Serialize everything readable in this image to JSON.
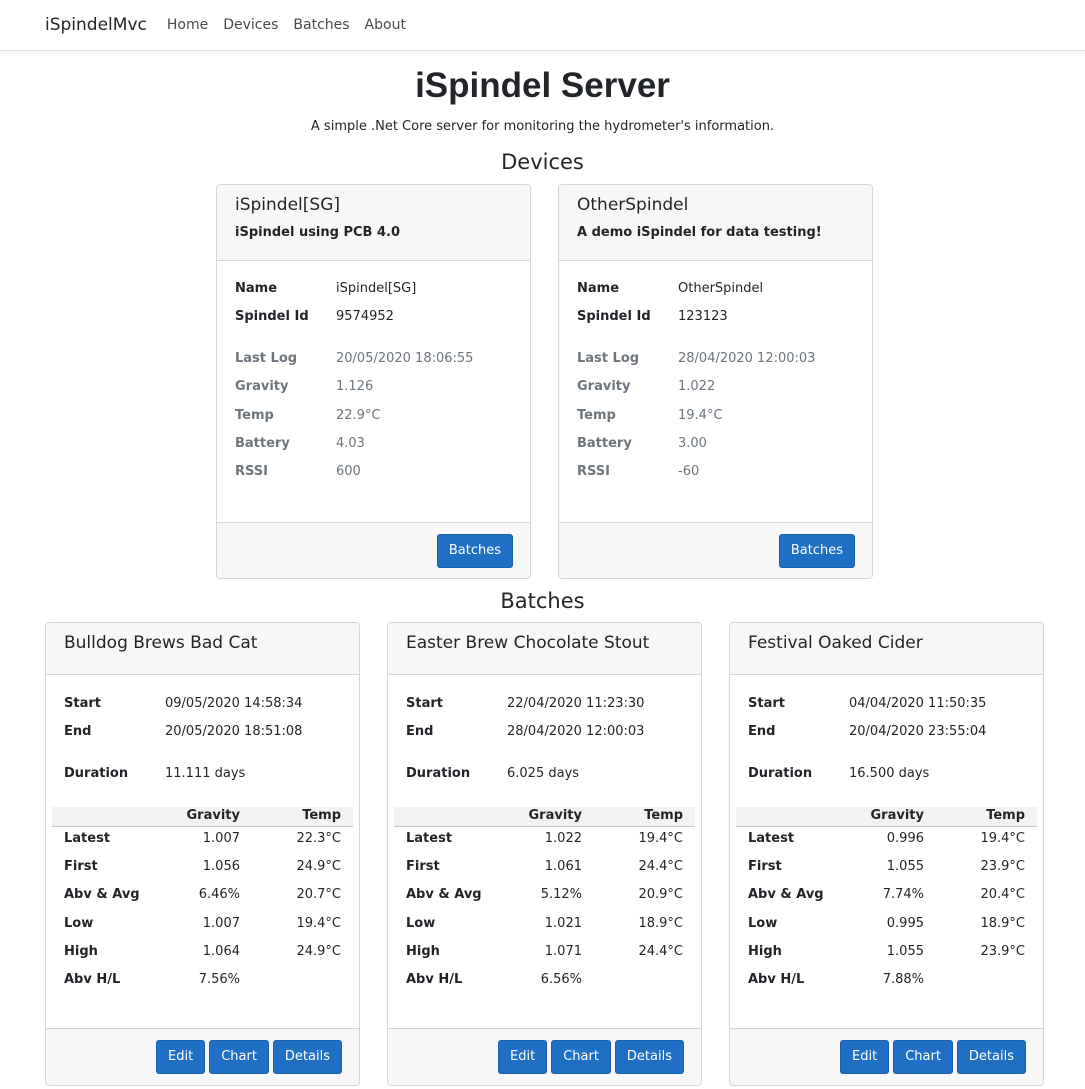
{
  "nav": {
    "brand": "iSpindelMvc",
    "links": [
      "Home",
      "Devices",
      "Batches",
      "About"
    ]
  },
  "page": {
    "title": "iSpindel Server",
    "subtitle": "A simple .Net Core server for monitoring the hydrometer's information."
  },
  "sections": {
    "devices": "Devices",
    "batches": "Batches"
  },
  "device_labels": {
    "name": "Name",
    "spindel_id": "Spindel Id",
    "last_log": "Last Log",
    "gravity": "Gravity",
    "temp": "Temp",
    "battery": "Battery",
    "rssi": "RSSI",
    "batches_button": "Batches"
  },
  "devices": [
    {
      "title": "iSpindel[SG]",
      "description": "iSpindel using PCB 4.0",
      "name": "iSpindel[SG]",
      "spindel_id": "9574952",
      "last_log": "20/05/2020 18:06:55",
      "gravity": "1.126",
      "temp": "22.9°C",
      "battery": "4.03",
      "rssi": "600"
    },
    {
      "title": "OtherSpindel",
      "description": "A demo iSpindel for data testing!",
      "name": "OtherSpindel",
      "spindel_id": "123123",
      "last_log": "28/04/2020 12:00:03",
      "gravity": "1.022",
      "temp": "19.4°C",
      "battery": "3.00",
      "rssi": "-60"
    }
  ],
  "batch_labels": {
    "start": "Start",
    "end": "End",
    "duration": "Duration",
    "gravity_col": "Gravity",
    "temp_col": "Temp",
    "latest": "Latest",
    "first": "First",
    "abv_avg": "Abv & Avg",
    "low": "Low",
    "high": "High",
    "abv_hl": "Abv H/L",
    "edit_button": "Edit",
    "chart_button": "Chart",
    "details_button": "Details"
  },
  "batches": [
    {
      "title": "Bulldog Brews Bad Cat",
      "start": "09/05/2020 14:58:34",
      "end": "20/05/2020 18:51:08",
      "duration": "11.111 days",
      "latest": [
        "1.007",
        "22.3°C"
      ],
      "first": [
        "1.056",
        "24.9°C"
      ],
      "abv_avg": [
        "6.46%",
        "20.7°C"
      ],
      "low": [
        "1.007",
        "19.4°C"
      ],
      "high": [
        "1.064",
        "24.9°C"
      ],
      "abv_hl": "7.56%"
    },
    {
      "title": "Easter Brew Chocolate Stout",
      "start": "22/04/2020 11:23:30",
      "end": "28/04/2020 12:00:03",
      "duration": "6.025 days",
      "latest": [
        "1.022",
        "19.4°C"
      ],
      "first": [
        "1.061",
        "24.4°C"
      ],
      "abv_avg": [
        "5.12%",
        "20.9°C"
      ],
      "low": [
        "1.021",
        "18.9°C"
      ],
      "high": [
        "1.071",
        "24.4°C"
      ],
      "abv_hl": "6.56%"
    },
    {
      "title": "Festival Oaked Cider",
      "start": "04/04/2020 11:50:35",
      "end": "20/04/2020 23:55:04",
      "duration": "16.500 days",
      "latest": [
        "0.996",
        "19.4°C"
      ],
      "first": [
        "1.055",
        "23.9°C"
      ],
      "abv_avg": [
        "7.74%",
        "20.4°C"
      ],
      "low": [
        "0.995",
        "18.9°C"
      ],
      "high": [
        "1.055",
        "23.9°C"
      ],
      "abv_hl": "7.88%"
    }
  ]
}
